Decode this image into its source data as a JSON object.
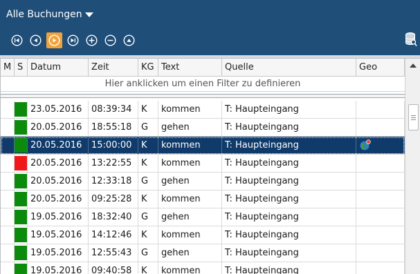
{
  "toolbar": {
    "title": "Alle Buchungen",
    "nav_buttons": [
      "first-record-icon",
      "previous-record-icon",
      "next-record-icon",
      "last-record-icon",
      "add-record-icon",
      "remove-record-icon",
      "collapse-up-icon"
    ],
    "active_button": "next-record-icon"
  },
  "grid": {
    "columns": [
      "M",
      "S",
      "Datum",
      "Zeit",
      "KG",
      "Text",
      "Quelle",
      "Geo"
    ],
    "filter_hint": "Hier anklicken um einen Filter zu definieren",
    "rows": [
      {
        "status": "#0b8a0b",
        "date": "23.05.2016",
        "time": "08:39:34",
        "kg": "K",
        "text": "kommen",
        "source": "T: Haupteingang",
        "geo": ""
      },
      {
        "status": "#0b8a0b",
        "date": "20.05.2016",
        "time": "18:55:18",
        "kg": "G",
        "text": "gehen",
        "source": "T: Haupteingang",
        "geo": ""
      },
      {
        "status": "#0b8a0b",
        "date": "20.05.2016",
        "time": "15:00:00",
        "kg": "K",
        "text": "kommen",
        "source": "T: Haupteingang",
        "geo": "globe-location-icon",
        "selected": true
      },
      {
        "status": "#f01818",
        "date": "20.05.2016",
        "time": "13:22:55",
        "kg": "K",
        "text": "kommen",
        "source": "T: Haupteingang",
        "geo": ""
      },
      {
        "status": "#0b8a0b",
        "date": "20.05.2016",
        "time": "12:33:18",
        "kg": "G",
        "text": "gehen",
        "source": "T: Haupteingang",
        "geo": ""
      },
      {
        "status": "#0b8a0b",
        "date": "20.05.2016",
        "time": "09:25:28",
        "kg": "K",
        "text": "kommen",
        "source": "T: Haupteingang",
        "geo": ""
      },
      {
        "status": "#0b8a0b",
        "date": "19.05.2016",
        "time": "18:32:40",
        "kg": "G",
        "text": "gehen",
        "source": "T: Haupteingang",
        "geo": ""
      },
      {
        "status": "#0b8a0b",
        "date": "19.05.2016",
        "time": "14:12:46",
        "kg": "K",
        "text": "kommen",
        "source": "T: Haupteingang",
        "geo": ""
      },
      {
        "status": "#0b8a0b",
        "date": "19.05.2016",
        "time": "12:55:43",
        "kg": "G",
        "text": "gehen",
        "source": "T: Haupteingang",
        "geo": ""
      },
      {
        "status": "#0b8a0b",
        "date": "19.05.2016",
        "time": "09:40:58",
        "kg": "K",
        "text": "kommen",
        "source": "T: Haupteingang",
        "geo": ""
      }
    ]
  },
  "colors": {
    "header_blue": "#1f4e79",
    "selection": "#0f3a69",
    "active_button": "#f0a33c",
    "status_ok": "#0b8a0b",
    "status_error": "#f01818"
  },
  "icons": {
    "dropdown": "caret-down-icon",
    "database": "database-search-icon",
    "scroll_up": "scroll-up-arrow-icon",
    "scroll_thumb": "scroll-thumb-grip-icon"
  }
}
